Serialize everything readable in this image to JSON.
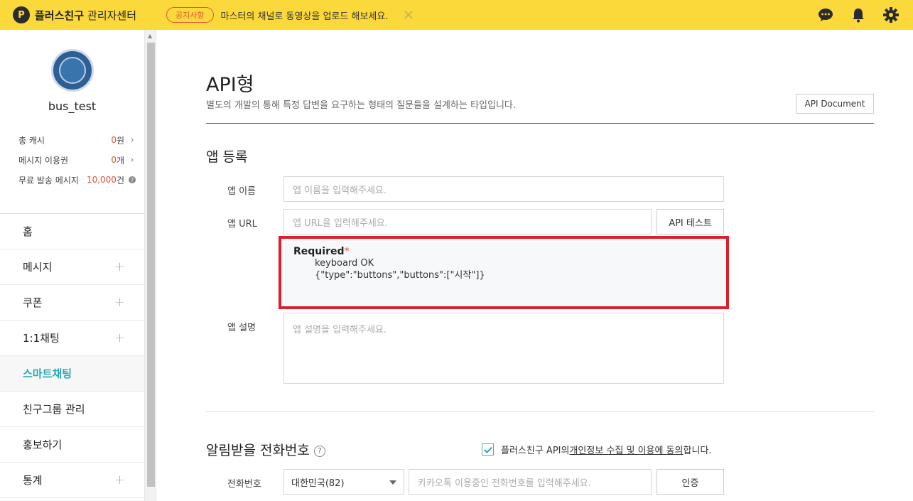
{
  "topbar": {
    "logo_glyph": "P",
    "brand_name": "플러스친구",
    "brand_sub": "관리자센터",
    "notice_badge": "공지사항",
    "notice_text": "마스터의 채널로 동영상을 업로드 해보세요.",
    "close_glyph": "✕",
    "icons": [
      "chat-icon",
      "bell-icon",
      "gear-icon"
    ],
    "background": "#fcd93a"
  },
  "sidebar": {
    "profile_name": "bus_test",
    "stats": [
      {
        "label": "총 캐시",
        "value": "0",
        "unit": "원"
      },
      {
        "label": "메시지 이용권",
        "value": "0",
        "unit": "개"
      },
      {
        "label": "무료 발송 메시지",
        "value": "10,000",
        "unit": "건"
      }
    ],
    "menu": [
      {
        "label": "홈",
        "plus": ""
      },
      {
        "label": "메시지",
        "plus": "+"
      },
      {
        "label": "쿠폰",
        "plus": "+"
      },
      {
        "label": "1:1채팅",
        "plus": "+"
      },
      {
        "label": "스마트채팅",
        "plus": ""
      },
      {
        "label": "친구그룹 관리",
        "plus": ""
      },
      {
        "label": "홍보하기",
        "plus": ""
      },
      {
        "label": "통계",
        "plus": "+"
      }
    ],
    "active_color": "#2aa9b6"
  },
  "main": {
    "title": "API형",
    "description": "별도의 개발의 통해 특정 답변을 요구하는 형태의 질문들을 설계하는 타입입니다.",
    "api_document_button": "API Document",
    "app_section_title": "앱 등록",
    "app_name_label": "앱 이름",
    "app_name_placeholder": "앱 이름을 입력해주세요.",
    "app_url_label": "앱 URL",
    "app_url_placeholder": "앱 URL을 입력해주세요.",
    "api_test_button": "API 테스트",
    "required": {
      "title": "Required",
      "star": "*",
      "lines": [
        "keyboard OK",
        "{\"type\":\"buttons\",\"buttons\":[\"시작\"]}"
      ]
    },
    "app_desc_label": "앱 설명",
    "app_desc_placeholder": "앱 설명을 입력해주세요.",
    "phone_section_title": "알림받을 전화번호",
    "help_glyph": "?",
    "consent": {
      "checked": true,
      "prefix": "플러스친구 API의 ",
      "link": "개인정보 수집 및 이용에 동의",
      "suffix": "합니다."
    },
    "phone_label": "전화번호",
    "country_select": "대한민국(82)",
    "phone_placeholder": "카카오톡 이용중인 전화번호를 입력해주세요.",
    "verify_button": "인증",
    "highlight_color": "#d9202b"
  }
}
